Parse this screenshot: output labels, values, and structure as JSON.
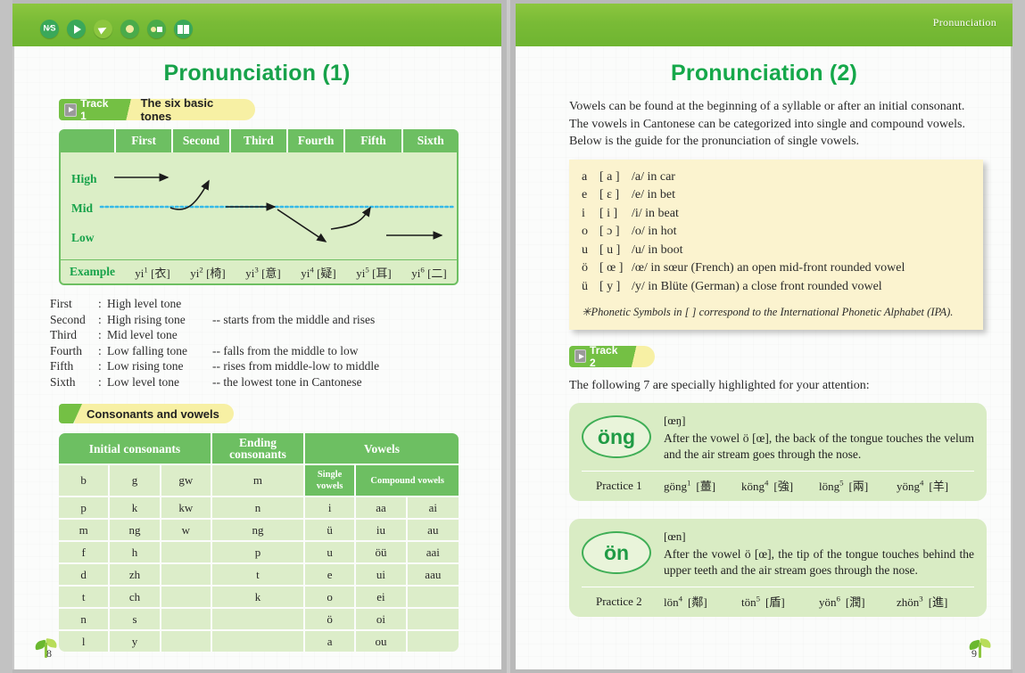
{
  "band": {
    "right_title": "Pronunciation",
    "icons": [
      {
        "name": "ns-compass-icon",
        "label": "N/S"
      },
      {
        "name": "play-icon",
        "label": "play"
      },
      {
        "name": "pencil-icon",
        "label": "write"
      },
      {
        "name": "dot-icon",
        "label": "dot"
      },
      {
        "name": "dot-square-icon",
        "label": "dot-square"
      },
      {
        "name": "book-icon",
        "label": "book"
      }
    ]
  },
  "left": {
    "title": "Pronunciation (1)",
    "track": {
      "label": "Track 1",
      "heading": "The six basic tones"
    },
    "tone_table": {
      "columns": [
        "",
        "First",
        "Second",
        "Third",
        "Fourth",
        "Fifth",
        "Sixth"
      ],
      "levels": [
        "High",
        "Mid",
        "Low"
      ],
      "example_label": "Example",
      "examples": [
        "yi1 [衣]",
        "yi2 [椅]",
        "yi3 [意]",
        "yi4 [疑]",
        "yi5 [耳]",
        "yi6 [二]"
      ],
      "examples_parts": [
        {
          "syl": "yi",
          "tone": "1",
          "han": "[衣]"
        },
        {
          "syl": "yi",
          "tone": "2",
          "han": "[椅]"
        },
        {
          "syl": "yi",
          "tone": "3",
          "han": "[意]"
        },
        {
          "syl": "yi",
          "tone": "4",
          "han": "[疑]"
        },
        {
          "syl": "yi",
          "tone": "5",
          "han": "[耳]"
        },
        {
          "syl": "yi",
          "tone": "6",
          "han": "[二]"
        }
      ]
    },
    "tone_descriptions": [
      {
        "num": "First",
        "colon": ":",
        "tone": "High level tone",
        "note": ""
      },
      {
        "num": "Second",
        "colon": ":",
        "tone": "High rising tone",
        "note": "-- starts from the middle and rises"
      },
      {
        "num": "Third",
        "colon": ":",
        "tone": "Mid level tone",
        "note": ""
      },
      {
        "num": "Fourth",
        "colon": ":",
        "tone": "Low falling tone",
        "note": "-- falls from the middle to low"
      },
      {
        "num": "Fifth",
        "colon": ":",
        "tone": "Low rising tone",
        "note": "-- rises from middle-low to middle"
      },
      {
        "num": "Sixth",
        "colon": ":",
        "tone": "Low level tone",
        "note": "-- the lowest tone in Cantonese"
      }
    ],
    "section2": {
      "heading": "Consonants and vowels"
    },
    "cv_table": {
      "group_headers": [
        "Initial consonants",
        "Ending consonants",
        "Vowels"
      ],
      "sub_headers": [
        "Single vowels",
        "Compound vowels"
      ],
      "rows": [
        [
          "b",
          "g",
          "gw",
          "m",
          "",
          "",
          ""
        ],
        [
          "p",
          "k",
          "kw",
          "n",
          "i",
          "aa",
          "ai"
        ],
        [
          "m",
          "ng",
          "w",
          "ng",
          "ü",
          "iu",
          "au"
        ],
        [
          "f",
          "h",
          "",
          "p",
          "u",
          "öü",
          "aai"
        ],
        [
          "d",
          "zh",
          "",
          "t",
          "e",
          "ui",
          "aau"
        ],
        [
          "t",
          "ch",
          "",
          "k",
          "o",
          "ei",
          ""
        ],
        [
          "n",
          "s",
          "",
          "",
          "ö",
          "oi",
          ""
        ],
        [
          "l",
          "y",
          "",
          "",
          "a",
          "ou",
          ""
        ]
      ]
    },
    "page_number": "8"
  },
  "right": {
    "title": "Pronunciation (2)",
    "intro": "Vowels can be found at the beginning of a syllable or after an initial consonant. The vowels in Cantonese can be categorized into single and compound vowels. Below is the guide for the pronunciation of single vowels.",
    "vowel_guide": [
      {
        "letter": "a",
        "ipa": "[ a ]",
        "desc": "/a/ in car"
      },
      {
        "letter": "e",
        "ipa": "[ ɛ ]",
        "desc": "/e/ in bet"
      },
      {
        "letter": "i",
        "ipa": "[ i ]",
        "desc": "/i/ in beat"
      },
      {
        "letter": "o",
        "ipa": "[ ɔ ]",
        "desc": "/o/ in hot"
      },
      {
        "letter": "u",
        "ipa": "[ u ]",
        "desc": "/u/ in boot"
      },
      {
        "letter": "ö",
        "ipa": "[ œ ]",
        "desc": "/œ/ in sœur (French) an open mid-front rounded vowel"
      },
      {
        "letter": "ü",
        "ipa": "[ y ]",
        "desc": "/y/ in Blüte (German) a close front rounded vowel"
      }
    ],
    "vowel_note": "✳Phonetic Symbols in [   ] correspond to the International Phonetic Alphabet (IPA).",
    "track": {
      "label": "Track 2"
    },
    "following_text": "The following 7 are specially highlighted for your attention:",
    "highlights": [
      {
        "symbol": "öng",
        "ipa": "[œŋ]",
        "desc": "After the vowel ö [œ], the back of the tongue touches the velum and the air stream goes through the nose.",
        "practice_label": "Practice 1",
        "practice": [
          {
            "syl": "göng",
            "tone": "1",
            "han": "[薑]"
          },
          {
            "syl": "köng",
            "tone": "4",
            "han": "[強]"
          },
          {
            "syl": "löng",
            "tone": "5",
            "han": "[兩]"
          },
          {
            "syl": "yöng",
            "tone": "4",
            "han": "[羊]"
          }
        ]
      },
      {
        "symbol": "ön",
        "ipa": "[œn]",
        "desc": "After the vowel ö [œ], the tip of the tongue touches behind the upper teeth and the air stream goes through the nose.",
        "practice_label": "Practice 2",
        "practice": [
          {
            "syl": "lön",
            "tone": "4",
            "han": "[鄰]"
          },
          {
            "syl": "tön",
            "tone": "5",
            "han": "[盾]"
          },
          {
            "syl": "yön",
            "tone": "6",
            "han": "[潤]"
          },
          {
            "syl": "zhön",
            "tone": "3",
            "han": "[進]"
          }
        ]
      }
    ],
    "page_number": "9"
  },
  "colors": {
    "band_green": "#79bb36",
    "title_green": "#17a24a",
    "header_green": "#6dbf62",
    "cell_green": "#dcedc9",
    "ribbon_yellow": "#f7f0a4",
    "yellow_box": "#fbf3cf",
    "highlight_box": "#d9ecc4",
    "mid_line_blue": "#35b9e8"
  }
}
